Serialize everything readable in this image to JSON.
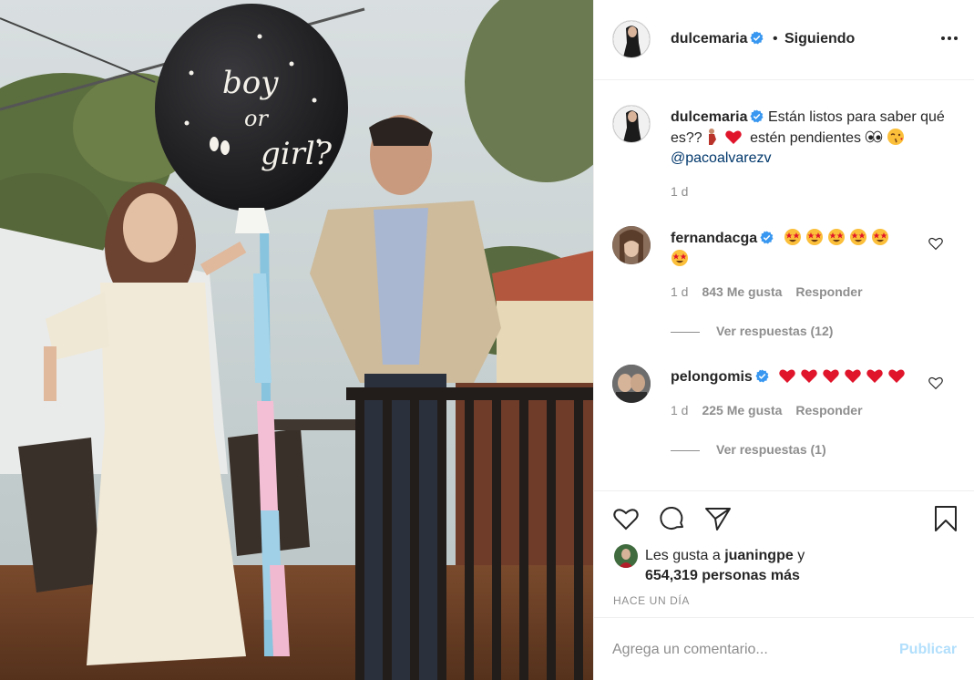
{
  "post": {
    "author": "dulcemaria",
    "separator": "•",
    "follow_status": "Siguiendo",
    "balloon_text": [
      "boy",
      "or",
      "girl?"
    ]
  },
  "caption": {
    "user": "dulcemaria",
    "text_1": "Están listos para saber qué es??",
    "text_2": "estén pendientes",
    "mention": "@pacoalvarezv",
    "time": "1 d"
  },
  "comments": [
    {
      "user": "fernandacga",
      "emoji": "star-struck-face x6",
      "time": "1 d",
      "likes": "843 Me gusta",
      "reply": "Responder",
      "view_replies": "Ver respuestas (12)"
    },
    {
      "user": "pelongomis",
      "emoji": "red-heart x6",
      "time": "1 d",
      "likes": "225 Me gusta",
      "reply": "Responder",
      "view_replies": "Ver respuestas (1)"
    }
  ],
  "likes": {
    "prefix": "Les gusta a",
    "first_user": "juaningpe",
    "conj": "y",
    "count_text": "654,319 personas más"
  },
  "date": "HACE UN DÍA",
  "add_comment": {
    "placeholder": "Agrega un comentario...",
    "publish": "Publicar"
  },
  "colors": {
    "verified": "#3897f0",
    "text": "#262626",
    "secondary": "#8e8e8e",
    "link": "#00376b",
    "publish_disabled": "#b2dffc",
    "border": "#efefef"
  },
  "icons": [
    "more-options-icon",
    "verified-badge-icon",
    "heart-icon",
    "comment-icon",
    "share-icon",
    "bookmark-icon"
  ]
}
